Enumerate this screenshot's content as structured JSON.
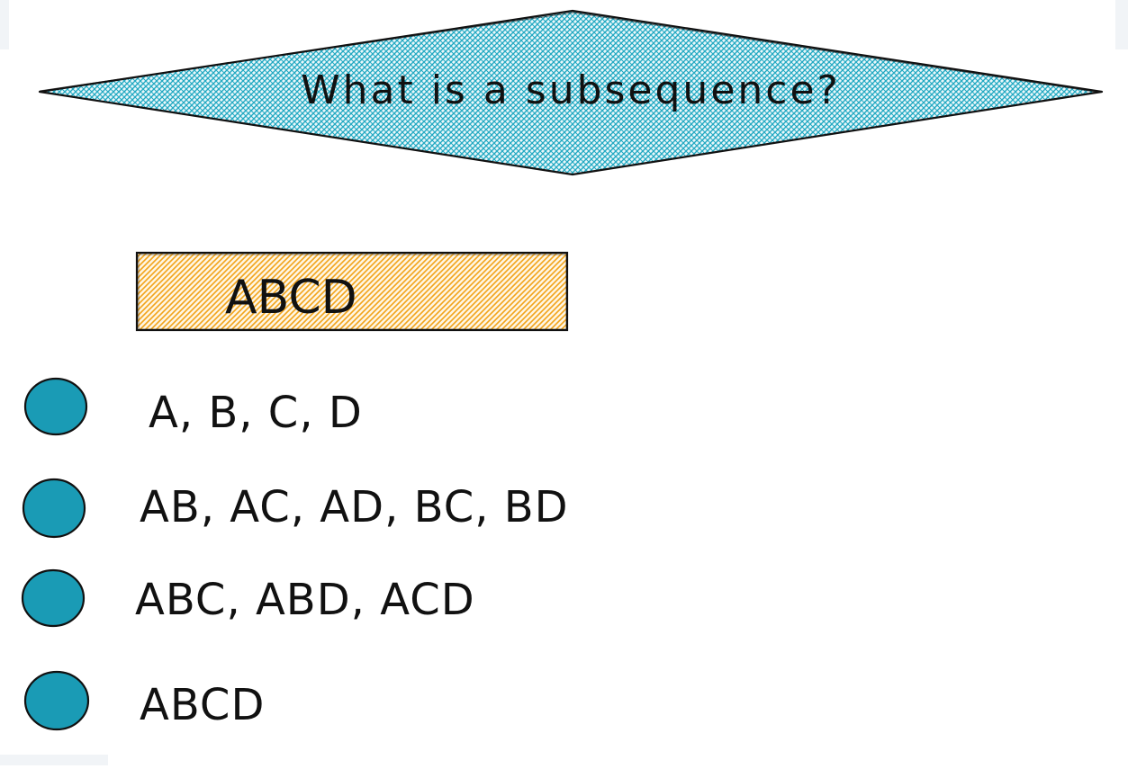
{
  "title": "What is a subsequence?",
  "sequence": "ABCD",
  "rows": [
    "A, B, C, D",
    "AB, AC, AD, BC, BD",
    "ABC, ABD, ACD",
    "ABCD"
  ],
  "colors": {
    "diamond_fill": "#22a9c2",
    "box_fill": "#f2a31a",
    "bullet_fill": "#1a9bb5",
    "stroke": "#111111"
  }
}
